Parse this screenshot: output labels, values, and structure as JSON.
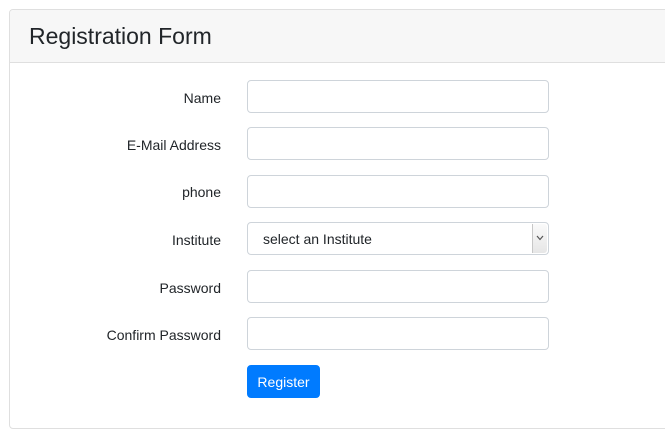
{
  "form": {
    "title": "Registration Form",
    "fields": {
      "name": {
        "label": "Name",
        "value": "",
        "placeholder": ""
      },
      "email": {
        "label": "E-Mail Address",
        "value": "",
        "placeholder": ""
      },
      "phone": {
        "label": "phone",
        "value": "",
        "placeholder": ""
      },
      "institute": {
        "label": "Institute",
        "selected": "select an Institute"
      },
      "password": {
        "label": "Password",
        "value": "",
        "placeholder": ""
      },
      "confirm_password": {
        "label": "Confirm Password",
        "value": "",
        "placeholder": ""
      }
    },
    "submit_label": "Register",
    "colors": {
      "primary": "#007bff",
      "header_bg": "#f7f7f7",
      "border": "#ced4da"
    }
  }
}
